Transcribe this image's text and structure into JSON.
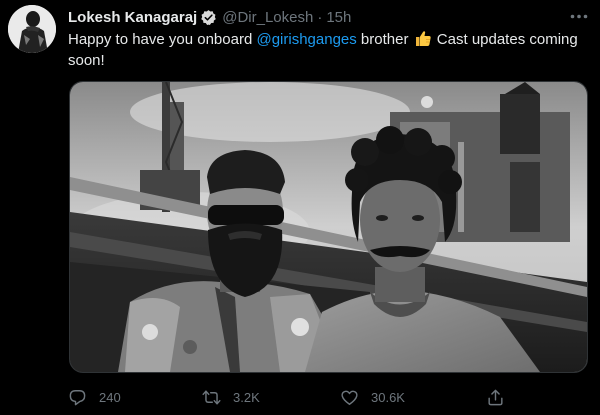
{
  "tweet": {
    "author_name": "Lokesh Kanagaraj",
    "author_handle": "@Dir_Lokesh",
    "separator": "·",
    "time": "15h",
    "text_before": "Happy to have you onboard ",
    "mention": "@girishganges",
    "text_middle": " brother ",
    "text_after": " Cast updates coming soon!",
    "emoji": "thumbs-up-icon"
  },
  "actions": {
    "reply_count": "240",
    "retweet_count": "3.2K",
    "like_count": "30.6K"
  },
  "colors": {
    "background": "#000000",
    "accent": "#1d9bf0",
    "secondary_text": "#6e767d",
    "verified": "#d9d9d9"
  }
}
